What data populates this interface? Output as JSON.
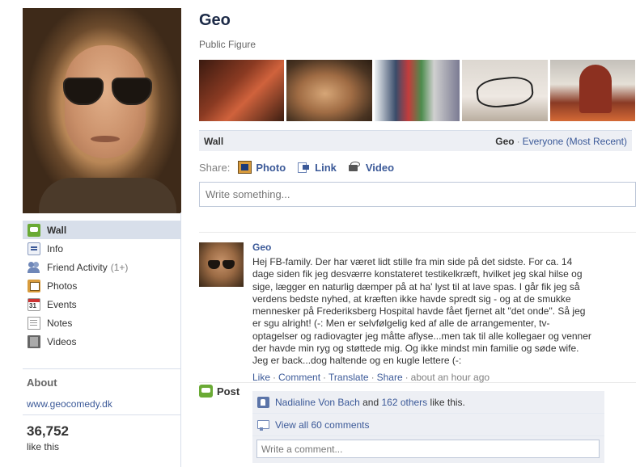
{
  "profile": {
    "name": "Geo",
    "category": "Public Figure"
  },
  "sidebar": {
    "items": [
      {
        "label": "Wall",
        "icon": "wall-icon",
        "active": true
      },
      {
        "label": "Info",
        "icon": "info-icon"
      },
      {
        "label": "Friend Activity",
        "count": "(1+)",
        "icon": "friends-icon"
      },
      {
        "label": "Photos",
        "icon": "photos-icon"
      },
      {
        "label": "Events",
        "icon": "events-icon"
      },
      {
        "label": "Notes",
        "icon": "notes-icon"
      },
      {
        "label": "Videos",
        "icon": "videos-icon"
      }
    ],
    "about_title": "About",
    "about_link": "www.geocomedy.dk",
    "likes_count": "36,752",
    "likes_label": "like this"
  },
  "wall_bar": {
    "title": "Wall",
    "owner": "Geo",
    "separator": "·",
    "filter": "Everyone (Most Recent)"
  },
  "share": {
    "label": "Share:",
    "buttons": [
      "Post",
      "Photo",
      "Link",
      "Video"
    ]
  },
  "composer": {
    "placeholder": "Write something..."
  },
  "post": {
    "author": "Geo",
    "text": "Hej FB-family. Der har været lidt stille fra min side på det sidste. For ca. 14\ndage siden fik jeg desværre konstateret testikelkræft, hvilket jeg skal hilse og\nsige, lægger en naturlig dæmper på at ha' lyst til at lave spas. I går fik jeg så\nverdens bedste nyhed, at kræften ikke havde spredt sig - og at de smukke\nmennesker på Frederiksberg Hospital havde fået fjernet alt \"det onde\". Så jeg\ner sgu alright! (-: Men er selvfølgelig ked af alle de arrangementer, tv-\noptagelser og radiovagter jeg måtte aflyse...men tak til alle kollegaer og venner\nder havde min ryg og støttede mig. Og ikke mindst min familie og søde wife.\nJeg er back...dog haltende og en kugle lettere (-:",
    "actions": [
      "Like",
      "Comment",
      "Translate",
      "Share"
    ],
    "dot": "·",
    "time": "about an hour ago",
    "likes": {
      "name": "Nadialine Von Bach",
      "and": "and",
      "others": "162 others",
      "suffix": "like this."
    },
    "view_comments": "View all 60 comments",
    "comment_placeholder": "Write a comment..."
  }
}
